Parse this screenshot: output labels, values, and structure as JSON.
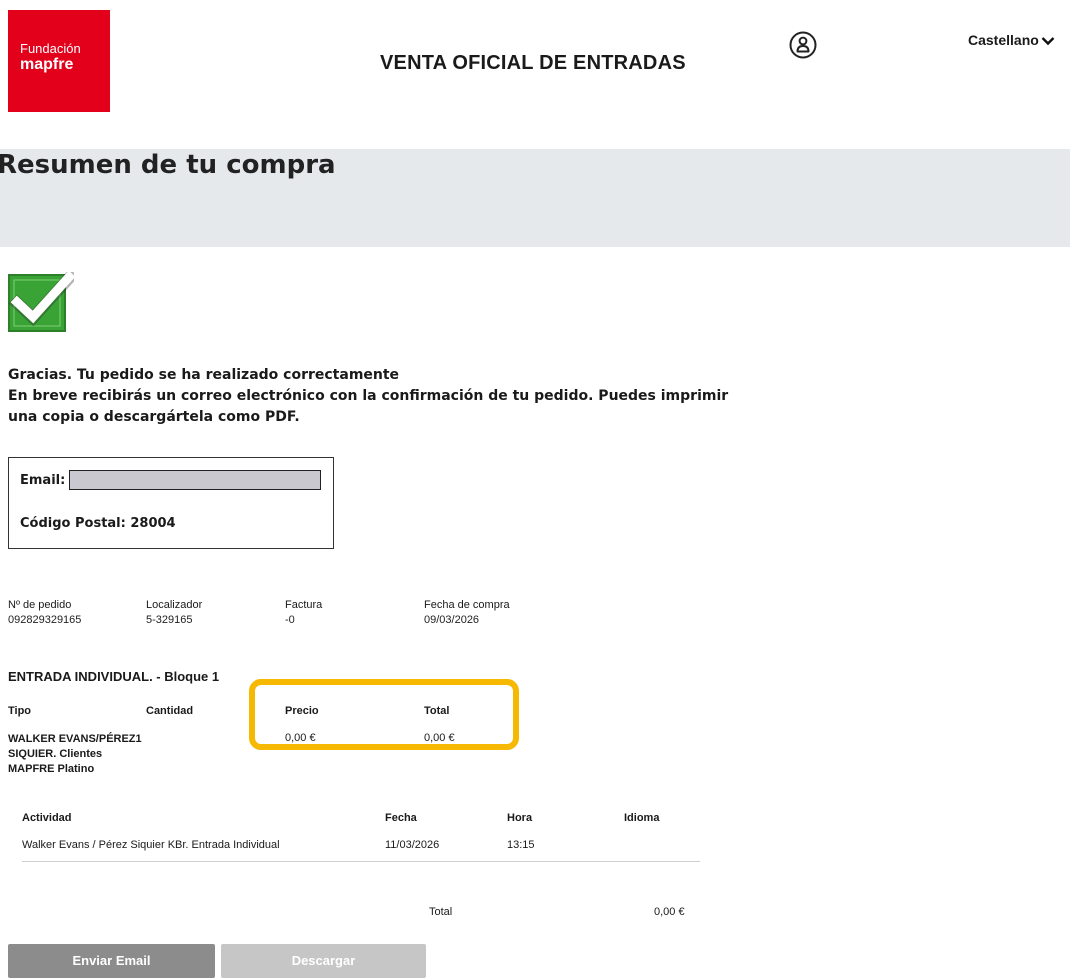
{
  "header": {
    "logo_line1": "Fundación",
    "logo_line2": "mapfre",
    "site_title": "VENTA OFICIAL DE ENTRADAS",
    "language": "Castellano"
  },
  "summary": {
    "title": "Resumen de tu compra"
  },
  "confirmation": {
    "line1": "Gracias. Tu pedido se ha realizado correctamente",
    "line2": "En breve recibirás un correo electrónico con la confirmación de tu pedido. Puedes imprimir",
    "line3": "una copia o descargártela como PDF."
  },
  "contact": {
    "email_label": "Email:",
    "postal_code_label": "Código Postal:",
    "postal_code_value": "28004"
  },
  "order": {
    "order_no_label": "Nº de pedido",
    "order_no_value": "092829329165",
    "locator_label": "Localizador",
    "locator_value": "5-329165",
    "invoice_label": "Factura",
    "invoice_value": "-0",
    "purchase_date_label": "Fecha de compra",
    "purchase_date_value": "09/03/2026"
  },
  "entry": {
    "title": "ENTRADA INDIVIDUAL. - Bloque 1",
    "headers": {
      "tipo": "Tipo",
      "cantidad": "Cantidad",
      "precio": "Precio",
      "total": "Total"
    },
    "tipo_lines": [
      "WALKER EVANS/PÉREZ",
      "SIQUIER. Clientes",
      "MAPFRE Platino"
    ],
    "cantidad": "1",
    "precio": "0,00 €",
    "total": "0,00 €"
  },
  "activity": {
    "headers": {
      "actividad": "Actividad",
      "fecha": "Fecha",
      "hora": "Hora",
      "idioma": "Idioma"
    },
    "row": {
      "actividad": "Walker Evans / Pérez Siquier KBr. Entrada Individual",
      "fecha": "11/03/2026",
      "hora": "13:15",
      "idioma": ""
    }
  },
  "grand_total": {
    "label": "Total",
    "value": "0,00 €"
  },
  "buttons": {
    "send_email": "Enviar Email",
    "download": "Descargar"
  },
  "colors": {
    "brand_red": "#e3001b",
    "highlight": "#f6b800",
    "summary_band": "#e6e9ec",
    "check_green": "#3aa336"
  },
  "icons": [
    "user-icon",
    "chevron-down-icon",
    "checkmark-icon"
  ]
}
